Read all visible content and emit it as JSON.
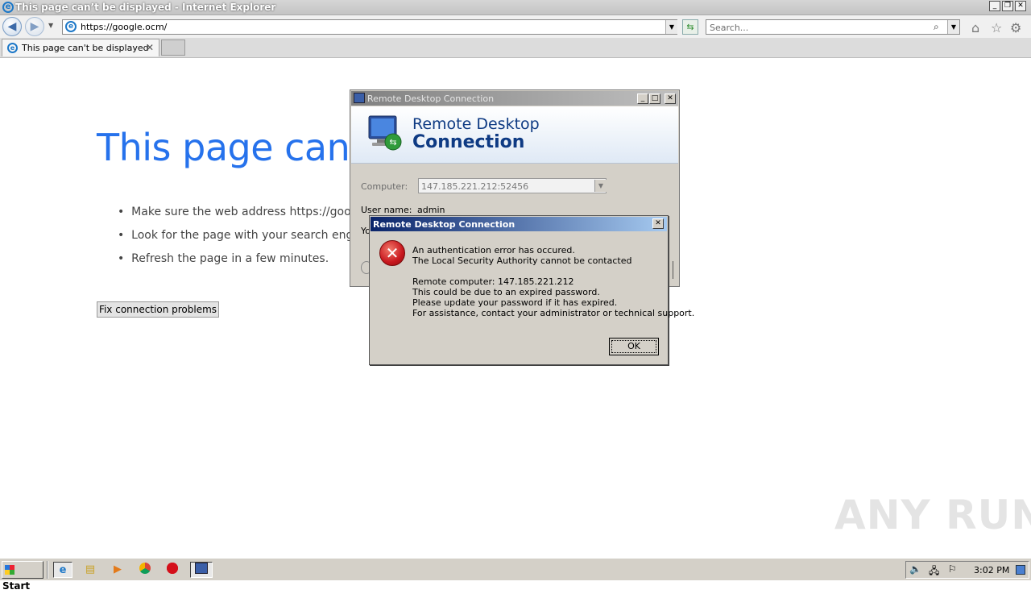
{
  "browser": {
    "window_title": "This page can’t be displayed - Internet Explorer",
    "address": "https://google.ocm/",
    "search_placeholder": "Search...",
    "tab_label": "This page can't be displayed"
  },
  "page": {
    "heading": "This page can’t",
    "bullets": [
      "Make sure the web address https://googl",
      "Look for the page with your search engin",
      "Refresh the page in a few minutes."
    ],
    "fix_button": "Fix connection problems"
  },
  "rdc": {
    "window_title": "Remote Desktop Connection",
    "banner_line1": "Remote Desktop",
    "banner_line2": "Connection",
    "computer_label": "Computer:",
    "computer_value": "147.185.221.212:52456",
    "username_label": "User name:",
    "username_value": "admin",
    "partial_text": "Yo"
  },
  "error_dialog": {
    "title": "Remote Desktop Connection",
    "lines": [
      "An authentication error has occured.",
      "The Local Security Authority cannot be contacted",
      "Remote computer: 147.185.221.212",
      "This could be due to an expired password.",
      "Please update your password if it has expired.",
      "For assistance, contact your administrator or technical support."
    ],
    "ok": "OK"
  },
  "watermark": "ANY RUN",
  "taskbar": {
    "start": "Start",
    "clock": "3:02 PM"
  }
}
